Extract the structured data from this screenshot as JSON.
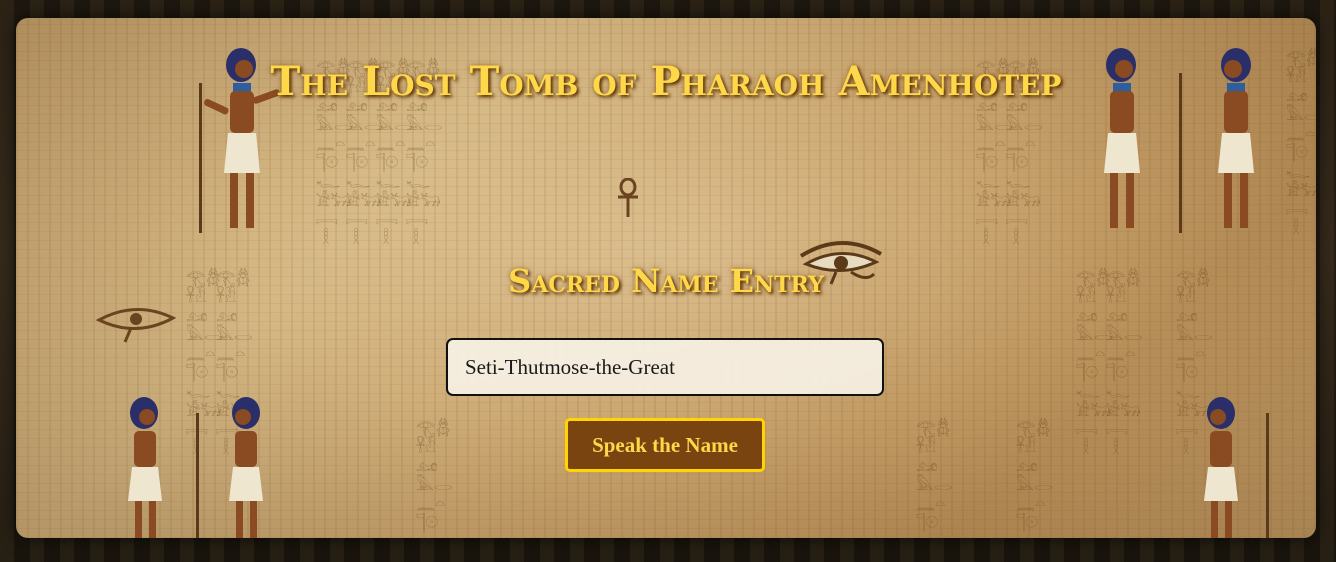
{
  "page": {
    "title": "The Lost Tomb of Pharaoh Amenhotep",
    "subtitle": "Sacred Name Entry"
  },
  "form": {
    "name_value": "Seti-Thutmose-the-Great",
    "speak_label": "Speak the Name"
  },
  "decor": {
    "glyphs": "𓂀𓆣𓋹𓁟𓃭𓅓𓂋𓈖𓏏𓊹𓇳𓆑𓀀𓃒𓇯𓎛",
    "icons": [
      "eye-of-horus-icon",
      "egyptian-figure-icon",
      "ankh-icon"
    ]
  },
  "colors": {
    "title": "#ffd84a",
    "button_bg": "#7a4410",
    "button_border": "#ffd400",
    "parchment": "#c9a874"
  }
}
